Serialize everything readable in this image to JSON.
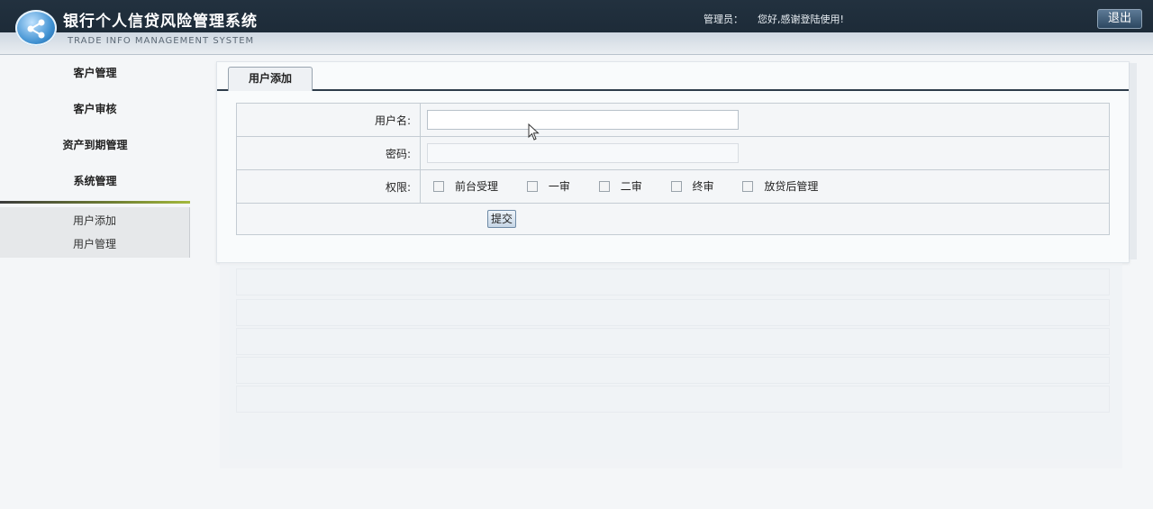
{
  "header": {
    "title": "银行个人信贷风险管理系统",
    "subtitle": "TRADE INFO MANAGEMENT SYSTEM",
    "admin_label": "管理员：",
    "welcome": "您好,感谢登陆使用!",
    "logout_label": "退出"
  },
  "sidebar": {
    "items": [
      {
        "label": "客户管理"
      },
      {
        "label": "客户审核"
      },
      {
        "label": "资产到期管理"
      },
      {
        "label": "系统管理"
      }
    ],
    "submenu": [
      {
        "label": "用户添加"
      },
      {
        "label": "用户管理"
      }
    ]
  },
  "main": {
    "tab": "用户添加",
    "form": {
      "username_label": "用户名:",
      "username_value": "",
      "password_label": "密码:",
      "password_value": "",
      "permission_label": "权限:",
      "permissions": [
        {
          "label": "前台受理",
          "checked": false
        },
        {
          "label": "一审",
          "checked": false
        },
        {
          "label": "二审",
          "checked": false
        },
        {
          "label": "终审",
          "checked": false
        },
        {
          "label": "放贷后管理",
          "checked": false
        }
      ],
      "submit_label": "提交"
    }
  },
  "icons": {
    "logo": "share-network-icon",
    "cursor": "mouse-pointer-icon"
  }
}
